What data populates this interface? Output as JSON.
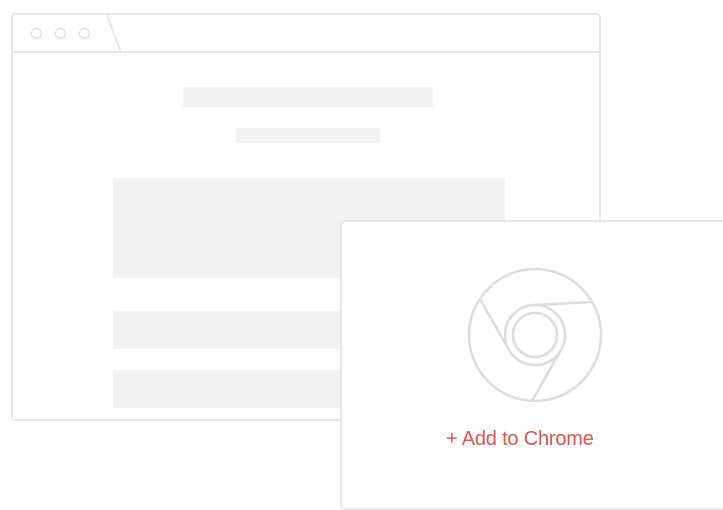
{
  "icons": {
    "window_dots": "circle-outline",
    "store_logo": "chrome-icon"
  },
  "colors": {
    "accent": "#e0524a",
    "outline": "#e6e6e6",
    "placeholder": "#f2f2f2"
  },
  "card": {
    "cta_label": "+ Add to Chrome"
  }
}
